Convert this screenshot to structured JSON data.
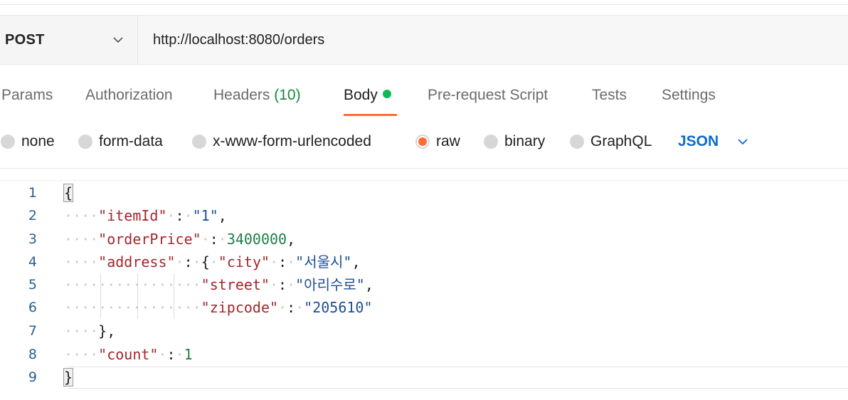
{
  "request": {
    "method": "POST",
    "url": "http://localhost:8080/orders"
  },
  "tabs": [
    {
      "label": "Params"
    },
    {
      "label": "Authorization"
    },
    {
      "label": "Headers",
      "count": "(10)"
    },
    {
      "label": "Body",
      "active": true
    },
    {
      "label": "Pre-request Script"
    },
    {
      "label": "Tests"
    },
    {
      "label": "Settings"
    }
  ],
  "body_types": [
    {
      "label": "none"
    },
    {
      "label": "form-data"
    },
    {
      "label": "x-www-form-urlencoded"
    },
    {
      "label": "raw",
      "selected": true
    },
    {
      "label": "binary"
    },
    {
      "label": "GraphQL"
    }
  ],
  "body_language": "JSON",
  "editor": {
    "line_numbers": [
      "1",
      "2",
      "3",
      "4",
      "5",
      "6",
      "7",
      "8",
      "9"
    ],
    "tokens": {
      "open_brace": "{",
      "k_itemId": "\"itemId\"",
      "v_itemId": "\"1\"",
      "k_orderPrice": "\"orderPrice\"",
      "v_orderPrice": "3400000",
      "k_address": "\"address\"",
      "k_city": "\"city\"",
      "v_city": "\"서울시\"",
      "k_street": "\"street\"",
      "v_street": "\"아리수로\"",
      "k_zipcode": "\"zipcode\"",
      "v_zipcode": "\"205610\"",
      "close_address": "},",
      "k_count": "\"count\"",
      "v_count": "1",
      "close_brace": "}"
    }
  },
  "colors": {
    "accent": "#ff6c37",
    "active_dot": "#0cbb52",
    "json_link": "#0a6bd1"
  }
}
